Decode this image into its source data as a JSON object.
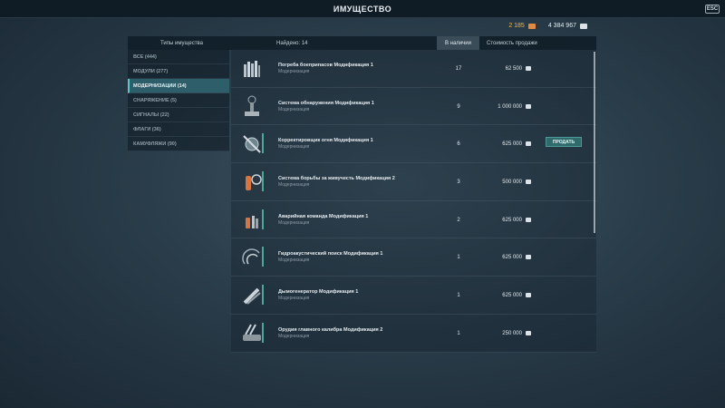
{
  "window": {
    "title": "ИМУЩЕСТВО",
    "esc_label": "ESC"
  },
  "currency": {
    "doubloons": "2 185",
    "credits": "4 384 967"
  },
  "header": {
    "types_label": "Типы имущества",
    "found_label": "Найдено: 14",
    "stock_label": "В наличии",
    "price_label": "Стоимость продажи"
  },
  "sidebar": {
    "items": [
      {
        "label": "ВСЕ (444)"
      },
      {
        "label": "МОДУЛИ (277)"
      },
      {
        "label": "МОДЕРНИЗАЦИИ (14)"
      },
      {
        "label": "СНАРЯЖЕНИЕ (5)"
      },
      {
        "label": "СИГНАЛЫ (22)"
      },
      {
        "label": "ФЛАГИ (36)"
      },
      {
        "label": "КАМУФЛЯЖИ (90)"
      }
    ],
    "active_index": 2
  },
  "items": [
    {
      "name": "Погреба боеприпасов Модификация 1",
      "category": "Модернизация",
      "count": "17",
      "price": "62 500",
      "icon": "ammo-shells-icon"
    },
    {
      "name": "Система обнаружения Модификация 1",
      "category": "Модернизация",
      "count": "9",
      "price": "1 000 000",
      "icon": "radar-tower-icon"
    },
    {
      "name": "Корректировщик огня Модификация 1",
      "category": "Модернизация",
      "count": "6",
      "price": "625 000",
      "icon": "aiming-system-icon"
    },
    {
      "name": "Система борьбы за живучесть Модификация 2",
      "category": "Модернизация",
      "count": "3",
      "price": "500 000",
      "icon": "fire-extinguisher-icon"
    },
    {
      "name": "Аварийная команда Модификация 1",
      "category": "Модернизация",
      "count": "2",
      "price": "625 000",
      "icon": "emergency-team-icon"
    },
    {
      "name": "Гидроакустический поиск Модификация 1",
      "category": "Модернизация",
      "count": "1",
      "price": "625 000",
      "icon": "hydroacoustic-icon"
    },
    {
      "name": "Дымогенератор Модификация 1",
      "category": "Модернизация",
      "count": "1",
      "price": "625 000",
      "icon": "smoke-generator-icon"
    },
    {
      "name": "Орудия главного калибра Модификация 2",
      "category": "Модернизация",
      "count": "1",
      "price": "250 000",
      "icon": "main-battery-icon"
    }
  ],
  "sell_button": {
    "label": "ПРОДАТЬ",
    "row_index": 2
  },
  "colors": {
    "accent": "#56c8c8",
    "doubloon": "#f0b64a",
    "active_tab": "#2e5e6a"
  }
}
